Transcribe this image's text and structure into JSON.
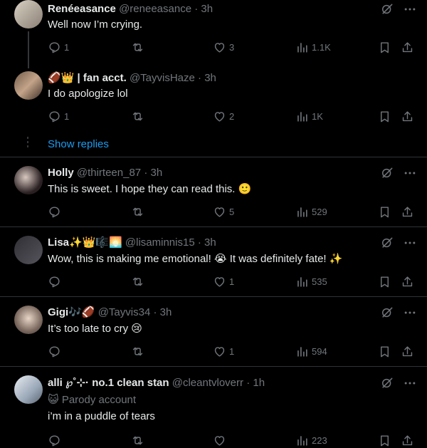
{
  "tweets": [
    {
      "name": "Renéeasance",
      "handle": "@reneeasance",
      "time": "· 3h",
      "text": "Well now I’m crying.",
      "replies": "1",
      "likes": "3",
      "views": "1.1K"
    },
    {
      "badge": "🏈👑",
      "name": "| fan acct.",
      "handle": "@TayvisHaze",
      "time": "· 3h",
      "text": "I do apologize lol",
      "replies": "1",
      "likes": "2",
      "views": "1K"
    },
    {
      "name": "Holly",
      "handle": "@thirteen_87",
      "time": "· 3h",
      "text": "This is sweet. I hope they can read this.",
      "emoji": "🙂",
      "likes": "5",
      "views": "529"
    },
    {
      "name": "Lisa",
      "badge": "✨👑🎼🌅",
      "handle": "@lisaminnis15",
      "time": "· 3h",
      "text": "Wow, this is making me emotional!",
      "emoji": "😭",
      "text2": "It was definitely fate!",
      "emoji2": "✨",
      "likes": "1",
      "views": "535"
    },
    {
      "name": "Gigi",
      "badge": "🎶🏈",
      "handle": "@Tayvis34",
      "time": "· 3h",
      "text": "It’s too late to cry",
      "emoji": "😢",
      "likes": "1",
      "views": "594"
    },
    {
      "name": "alli ℘˚⊹· no.1 clean stan",
      "handle": "@cleantvloverr",
      "time": "· 1h",
      "label": "Parody account",
      "label_icon": "😺",
      "text": "i’m in a puddle of tears",
      "views": "223"
    }
  ],
  "show_replies": "Show replies",
  "colors": {
    "bg": "#000000",
    "text": "#e7e9ea",
    "muted": "#71767b",
    "link": "#1d9bf0",
    "separator": "#2f3336"
  }
}
